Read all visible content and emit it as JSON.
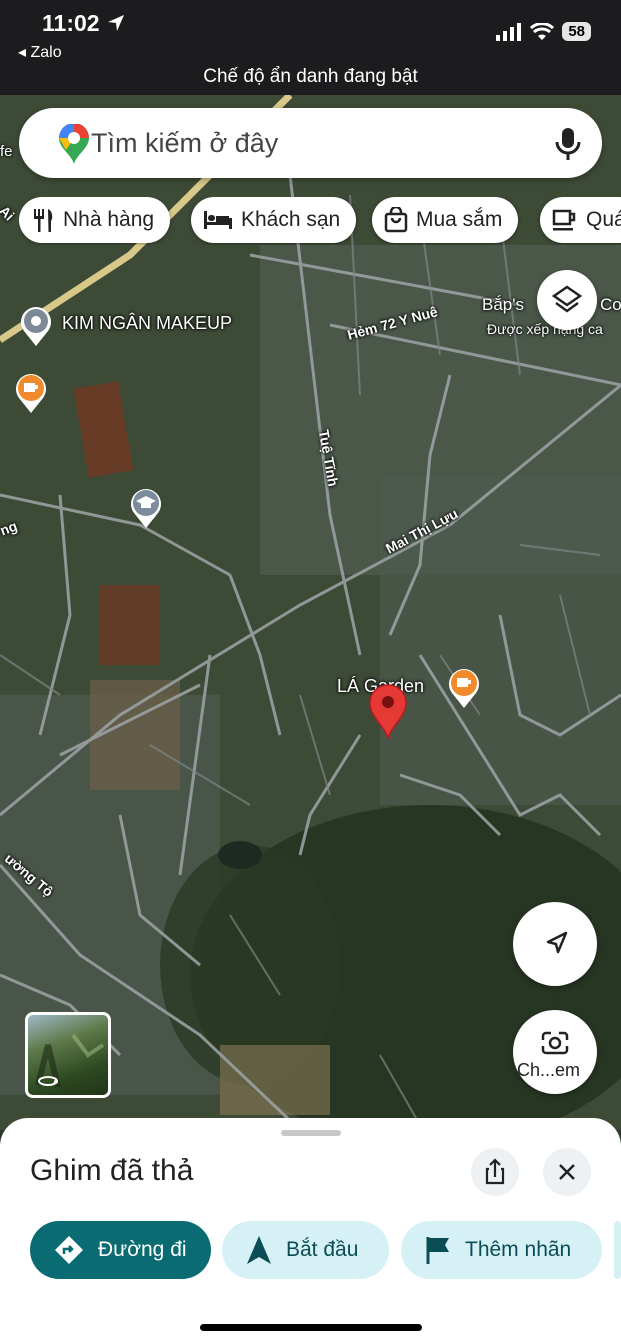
{
  "status_bar": {
    "time": "11:02",
    "back_app": "◂ Zalo",
    "battery": "58",
    "incognito_text": "Chế độ ẩn danh đang bật"
  },
  "search": {
    "placeholder": "Tìm kiếm ở đây"
  },
  "chips": [
    {
      "label": "Nhà hàng",
      "icon": "restaurant-icon"
    },
    {
      "label": "Khách sạn",
      "icon": "hotel-icon"
    },
    {
      "label": "Mua sắm",
      "icon": "shopping-icon"
    },
    {
      "label": "Quá",
      "icon": "coffee-icon"
    }
  ],
  "map_labels": {
    "kim_ngan": "KIM NGÂN MAKEUP",
    "baps": "Bắp's",
    "baps_suffix": "Co",
    "rating_text": "Được xếp hạng ca",
    "hem72": "Hẻm 72 Y Nuê",
    "tue_tinh": "Tuệ Tĩnh",
    "mai_thi_luu": "Mai Thị Lựu",
    "la_garden": "LÁ Garden",
    "ng": "ng",
    "fe": "fe",
    "ai": "Ai",
    "uong_to": "ường Tộ"
  },
  "controls": {
    "street_view_label": "Ch...em"
  },
  "sheet": {
    "title": "Ghim đã thả",
    "actions": [
      {
        "label": "Đường đi",
        "icon": "directions-icon"
      },
      {
        "label": "Bắt đầu",
        "icon": "navigation-arrow-icon"
      },
      {
        "label": "Thêm nhãn",
        "icon": "flag-icon"
      }
    ]
  },
  "colors": {
    "primary_action": "#0b6b72",
    "secondary_action": "#d6f1f6",
    "pin_red": "#e53935",
    "place_orange": "#f08a2c"
  }
}
